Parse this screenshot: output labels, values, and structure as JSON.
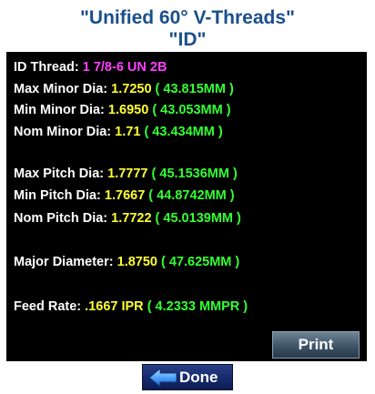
{
  "header": {
    "title_line1": "\"Unified 60° V-Threads\"",
    "title_line2": "\"ID\""
  },
  "details": {
    "id_thread": {
      "label": "ID Thread:",
      "value": "1 7/8-6 UN 2B"
    },
    "max_minor_dia": {
      "label": "Max Minor Dia:",
      "value": "1.7250",
      "mm": "( 43.815MM )"
    },
    "min_minor_dia": {
      "label": "Min Minor Dia:",
      "value": "1.6950",
      "mm": "( 43.053MM )"
    },
    "nom_minor_dia": {
      "label": "Nom Minor Dia:",
      "value": "1.71",
      "mm": "( 43.434MM )"
    },
    "max_pitch_dia": {
      "label": "Max Pitch Dia:",
      "value": "1.7777",
      "mm": "( 45.1536MM )"
    },
    "min_pitch_dia": {
      "label": "Min Pitch Dia:",
      "value": "1.7667",
      "mm": "( 44.8742MM )"
    },
    "nom_pitch_dia": {
      "label": "Nom Pitch Dia:",
      "value": "1.7722",
      "mm": "( 45.0139MM )"
    },
    "major_diameter": {
      "label": "Major Diameter:",
      "value": "1.8750",
      "mm": "( 47.625MM )"
    },
    "feed_rate": {
      "label": "Feed Rate:",
      "value": ".1667 IPR",
      "mm": "( 4.2333 MMPR )"
    }
  },
  "buttons": {
    "print_label": "Print",
    "done_label": "Done"
  },
  "icons": {
    "back": "left-arrow-icon"
  },
  "colors": {
    "title": "#1a4f8c",
    "panel_bg": "#000000",
    "label": "#ffffff",
    "thread_value": "#ff3fff",
    "inch_value": "#ffff33",
    "mm_value": "#33ff33"
  }
}
